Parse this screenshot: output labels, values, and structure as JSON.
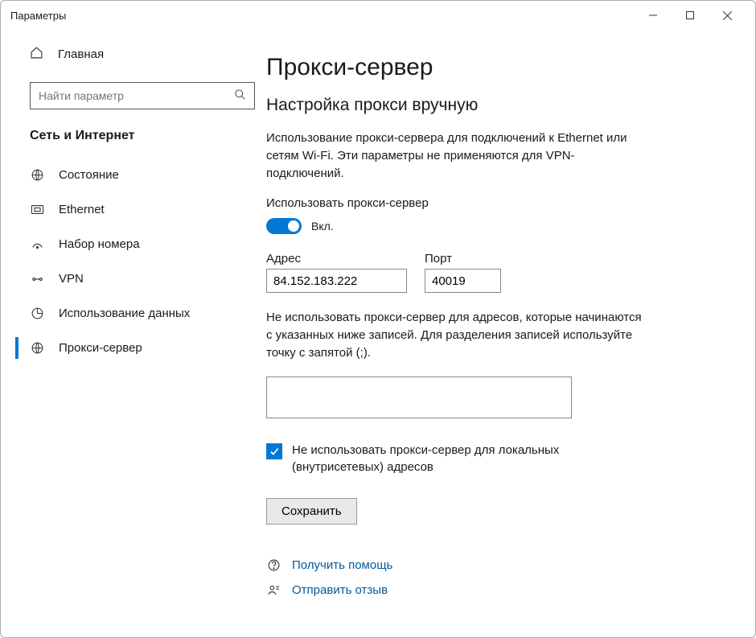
{
  "window": {
    "title": "Параметры"
  },
  "sidebar": {
    "home_label": "Главная",
    "search_placeholder": "Найти параметр",
    "category": "Сеть и Интернет",
    "items": [
      {
        "label": "Состояние"
      },
      {
        "label": "Ethernet"
      },
      {
        "label": "Набор номера"
      },
      {
        "label": "VPN"
      },
      {
        "label": "Использование данных"
      },
      {
        "label": "Прокси-сервер"
      }
    ]
  },
  "page": {
    "title": "Прокси-сервер",
    "section_title": "Настройка прокси вручную",
    "desc": "Использование прокси-сервера для подключений к Ethernet или сетям Wi-Fi. Эти параметры не применяются для VPN-подключений.",
    "use_proxy_label": "Использовать прокси-сервер",
    "toggle_state": "Вкл.",
    "address_label": "Адрес",
    "address_value": "84.152.183.222",
    "port_label": "Порт",
    "port_value": "40019",
    "exclusion_desc": "Не использовать прокси-сервер для адресов, которые начинаются с указанных ниже записей. Для разделения записей используйте точку с запятой (;).",
    "exclusion_value": "",
    "local_checkbox_label": "Не использовать прокси-сервер для локальных (внутрисетевых) адресов",
    "save_label": "Сохранить",
    "help_label": "Получить помощь",
    "feedback_label": "Отправить отзыв"
  }
}
